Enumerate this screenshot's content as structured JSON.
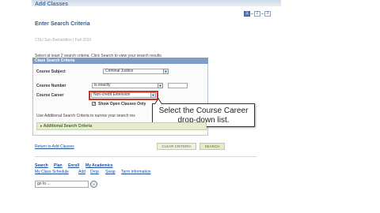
{
  "header": {
    "title": "Add Classes",
    "steps": [
      "1",
      "2",
      "3"
    ]
  },
  "section": {
    "title": "Enter Search Criteria",
    "term": "CSU San Bernardino | Fall 2010",
    "instructions": "Select at least 2 search criteria. Click Search to view your search results."
  },
  "criteria": {
    "header": "Class Search Criteria",
    "course_subject_label": "Course Subject",
    "course_subject_value": "Criminal Justice",
    "course_number_label": "Course Number",
    "course_number_operator": "is exactly",
    "course_career_label": "Course Career",
    "course_career_value": "Non-credit Extension",
    "open_only_label": "Show Open Classes Only",
    "open_only_checked": true
  },
  "callout": {
    "text": "Select the Course Career drop-down list."
  },
  "additional": {
    "note": "Use Additional Search Criteria to narrow your search res",
    "toggle_label": "Additional Search Criteria"
  },
  "actions": {
    "return_link": "Return to Add Classes",
    "clear_button": "CLEAR CRITERIA",
    "search_button": "SEARCH"
  },
  "nav": {
    "primary": [
      "Search",
      "Plan",
      "Enroll",
      "My Academics"
    ],
    "secondary": [
      "My Class Schedule",
      "Add",
      "Drop",
      "Swap",
      "Term Information"
    ]
  },
  "goto": {
    "value": "go to ...",
    "button": "»"
  },
  "colors": {
    "header_blue": "#7f9cc3",
    "link_blue": "#1f4e9c",
    "highlight_red": "#c0392b",
    "search_green": "#e4eccc"
  }
}
